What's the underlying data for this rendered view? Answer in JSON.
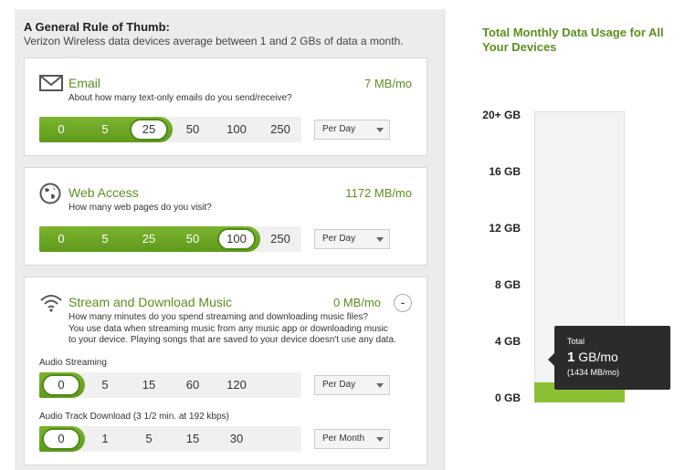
{
  "intro": {
    "title": "A General Rule of Thumb:",
    "subtitle": "Verizon Wireless data devices average between 1 and 2 GBs of data a month."
  },
  "email": {
    "icon": "envelope-icon",
    "title": "Email",
    "question": "About how many text-only emails do you send/receive?",
    "value": "7 MB/mo",
    "options": [
      "0",
      "5",
      "25",
      "50",
      "100",
      "250"
    ],
    "selected_index": 2,
    "period": "Per Day"
  },
  "web": {
    "icon": "globe-icon",
    "title": "Web Access",
    "question": "How many web pages do you visit?",
    "value": "1172 MB/mo",
    "options": [
      "0",
      "5",
      "25",
      "50",
      "100",
      "250"
    ],
    "selected_index": 4,
    "period": "Per Day"
  },
  "music": {
    "icon": "wifi-icon",
    "title": "Stream and Download Music",
    "question": "How many minutes do you spend streaming and downloading music files?",
    "note": "You use data when streaming music from any music app or downloading music to your device. Playing songs that are saved to your device doesn't use any data.",
    "value": "0 MB/mo",
    "collapse": "-",
    "streaming": {
      "label": "Audio Streaming",
      "options": [
        "0",
        "5",
        "15",
        "60",
        "120"
      ],
      "selected_index": 0,
      "period": "Per Day"
    },
    "download": {
      "label": "Audio Track Download (3 1/2 min. at 192 kbps)",
      "options": [
        "0",
        "1",
        "5",
        "15",
        "30"
      ],
      "selected_index": 0,
      "period": "Per Month"
    }
  },
  "usage": {
    "title": "Total Monthly Data Usage for All Your Devices",
    "ticks": [
      "20+ GB",
      "16 GB",
      "12 GB",
      "8 GB",
      "4 GB",
      "0 GB"
    ],
    "max_gb": 20,
    "total_gb": 1.4,
    "tooltip": {
      "label": "Total",
      "value_bold": "1",
      "value_unit": " GB/mo",
      "detail": "(1434 MB/mo)"
    }
  },
  "colors": {
    "accent": "#5a8f1e",
    "slider_fill": "#6fa726",
    "bar_fill": "#8cc034",
    "tooltip_bg": "#2b2b2b"
  }
}
